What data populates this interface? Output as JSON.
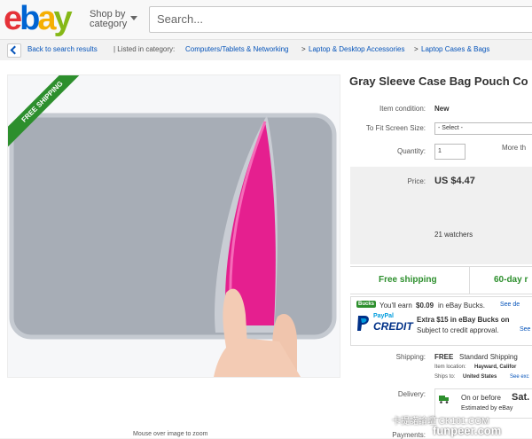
{
  "header": {
    "logo_letters": [
      "e",
      "b",
      "a",
      "y"
    ],
    "logo_colors": [
      "#e53238",
      "#0064d2",
      "#f5af02",
      "#86b817"
    ],
    "shop_by": "Shop by",
    "category": "category",
    "search_placeholder": "Search..."
  },
  "breadcrumb": {
    "back": "Back to search results",
    "listed_in": "| Listed in category:",
    "items": [
      "Computers/Tablets & Networking",
      "Laptop & Desktop Accessories",
      "Laptop Cases & Bags"
    ],
    "separator": ">"
  },
  "image": {
    "ribbon": "FREE SHIPPING",
    "mouse_over": "Mouse over image to zoom"
  },
  "product": {
    "title": "Gray Sleeve Case Bag Pouch Co",
    "condition_label": "Item condition:",
    "condition_value": "New",
    "fit_label": "To Fit Screen Size:",
    "fit_value": "- Select -",
    "qty_label": "Quantity:",
    "qty_value": "1",
    "more_than": "More th",
    "price_label": "Price:",
    "price_value": "US $4.47",
    "watchers": "21 watchers",
    "free_shipping": "Free shipping",
    "returns": "60-day r"
  },
  "bucks": {
    "badge": "Bucks",
    "earn_text": "You'll earn",
    "earn_amount": "$0.09",
    "earn_suffix": "in eBay Bucks.",
    "see_details": "See de",
    "paypal": "PayPal",
    "credit": "CREDIT",
    "extra_text": "Extra $15 in eBay Bucks on",
    "approval": "Subject to credit approval.",
    "see": "See"
  },
  "shipping": {
    "label": "Shipping:",
    "free": "FREE",
    "standard": "Standard Shipping",
    "location_label": "Item location:",
    "location_value": "Hayward, Califor",
    "ships_label": "Ships to:",
    "ships_value": "United States",
    "see": "See exc"
  },
  "delivery": {
    "label": "Delivery:",
    "on_or_before": "On or before",
    "date": "Sat.",
    "estimated": "Estimated by eBay"
  },
  "payments": {
    "label": "Payments:"
  },
  "watermarks": {
    "top": "卡提諾論壇 CK101.COM",
    "bottom": "funpeer.com"
  }
}
